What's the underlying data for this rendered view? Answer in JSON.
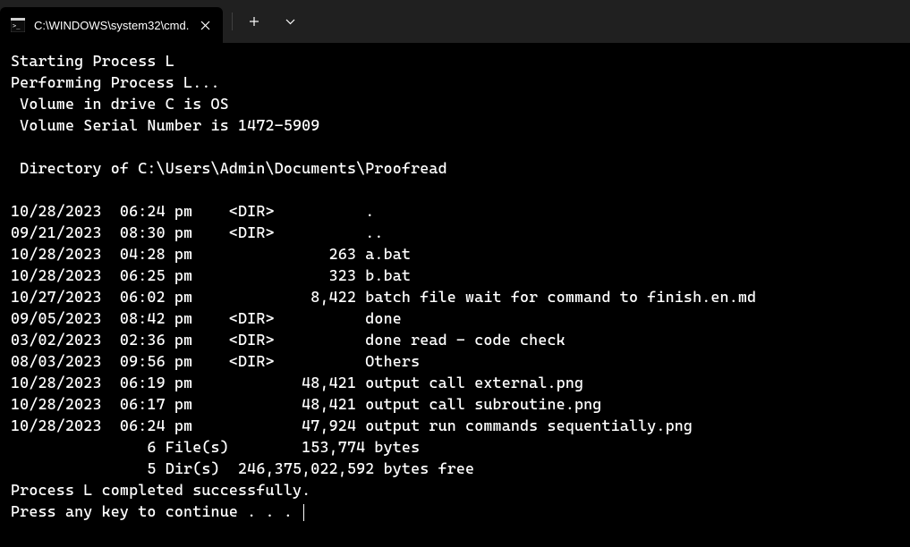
{
  "titlebar": {
    "tab_title": "C:\\WINDOWS\\system32\\cmd.",
    "new_tab_label": "+",
    "dropdown_label": "⌄"
  },
  "terminal": {
    "lines": [
      "Starting Process L",
      "Performing Process L...",
      " Volume in drive C is OS",
      " Volume Serial Number is 1472-5909",
      "",
      " Directory of C:\\Users\\Admin\\Documents\\Proofread",
      "",
      "10/28/2023  06:24 pm    <DIR>          .",
      "09/21/2023  08:30 pm    <DIR>          ..",
      "10/28/2023  04:28 pm               263 a.bat",
      "10/28/2023  06:25 pm               323 b.bat",
      "10/27/2023  06:02 pm             8,422 batch file wait for command to finish.en.md",
      "09/05/2023  08:42 pm    <DIR>          done",
      "03/02/2023  02:36 pm    <DIR>          done read - code check",
      "08/03/2023  09:56 pm    <DIR>          Others",
      "10/28/2023  06:19 pm            48,421 output call external.png",
      "10/28/2023  06:17 pm            48,421 output call subroutine.png",
      "10/28/2023  06:24 pm            47,924 output run commands sequentially.png",
      "               6 File(s)        153,774 bytes",
      "               5 Dir(s)  246,375,022,592 bytes free",
      "Process L completed successfully.",
      "Press any key to continue . . . "
    ]
  }
}
